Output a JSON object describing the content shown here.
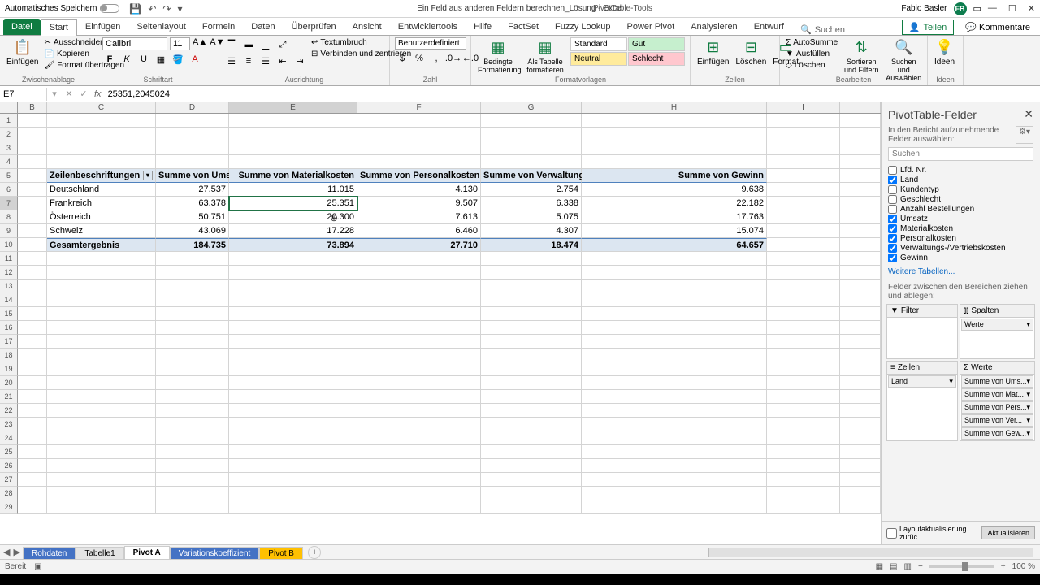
{
  "title_bar": {
    "autosave_label": "Automatisches Speichern",
    "doc_title": "Ein Feld aus anderen Feldern berechnen_Lösung - Excel",
    "pivot_tools": "PivotTable-Tools",
    "user_name": "Fabio Basler",
    "user_initials": "FB"
  },
  "tabs": {
    "file": "Datei",
    "home": "Start",
    "insert": "Einfügen",
    "pagelayout": "Seitenlayout",
    "formulas": "Formeln",
    "data": "Daten",
    "review": "Überprüfen",
    "view": "Ansicht",
    "developer": "Entwicklertools",
    "help": "Hilfe",
    "factset": "FactSet",
    "fuzzy": "Fuzzy Lookup",
    "powerpivot": "Power Pivot",
    "analyze": "Analysieren",
    "design": "Entwurf",
    "search": "Suchen",
    "share": "Teilen",
    "comments": "Kommentare"
  },
  "ribbon": {
    "paste": "Einfügen",
    "cut": "Ausschneiden",
    "copy": "Kopieren",
    "format_paint": "Format übertragen",
    "clipboard": "Zwischenablage",
    "font_name": "Calibri",
    "font_size": "11",
    "font_group": "Schriftart",
    "wrap": "Textumbruch",
    "merge": "Verbinden und zentrieren",
    "align_group": "Ausrichtung",
    "num_format": "Benutzerdefiniert",
    "num_group": "Zahl",
    "cond_fmt": "Bedingte Formatierung",
    "as_table": "Als Tabelle formatieren",
    "styles_group": "Formatvorlagen",
    "style_standard": "Standard",
    "style_gut": "Gut",
    "style_neutral": "Neutral",
    "style_schlecht": "Schlecht",
    "insert_cells": "Einfügen",
    "delete_cells": "Löschen",
    "format_cells": "Format",
    "cells_group": "Zellen",
    "autosum": "AutoSumme",
    "fill": "Ausfüllen",
    "clear": "Löschen",
    "sort": "Sortieren und Filtern",
    "find": "Suchen und Auswählen",
    "edit_group": "Bearbeiten",
    "ideas": "Ideen",
    "ideas_group": "Ideen"
  },
  "namebox": {
    "ref": "E7",
    "formula": "25351,2045024"
  },
  "cols": [
    "B",
    "C",
    "D",
    "E",
    "F",
    "G",
    "H",
    "I"
  ],
  "chart_data": {
    "type": "table",
    "title": "PivotTable",
    "columns": [
      "Zeilenbeschriftungen",
      "Summe von Umsatz",
      "Summe von Materialkosten",
      "Summe von Personalkosten",
      "Summe von Verwaltungs-/Vertriebskosten",
      "Summe von Gewinn"
    ],
    "rows": [
      {
        "label": "Deutschland",
        "vals": [
          "27.537",
          "11.015",
          "4.130",
          "2.754",
          "9.638"
        ]
      },
      {
        "label": "Frankreich",
        "vals": [
          "63.378",
          "25.351",
          "9.507",
          "6.338",
          "22.182"
        ]
      },
      {
        "label": "Österreich",
        "vals": [
          "50.751",
          "20.300",
          "7.613",
          "5.075",
          "17.763"
        ]
      },
      {
        "label": "Schweiz",
        "vals": [
          "43.069",
          "17.228",
          "6.460",
          "4.307",
          "15.074"
        ]
      }
    ],
    "total": {
      "label": "Gesamtergebnis",
      "vals": [
        "184.735",
        "73.894",
        "27.710",
        "18.474",
        "64.657"
      ]
    }
  },
  "pane": {
    "title": "PivotTable-Felder",
    "subtitle": "In den Bericht aufzunehmende Felder auswählen:",
    "search_ph": "Suchen",
    "fields": [
      {
        "name": "Lfd. Nr.",
        "checked": false
      },
      {
        "name": "Land",
        "checked": true
      },
      {
        "name": "Kundentyp",
        "checked": false
      },
      {
        "name": "Geschlecht",
        "checked": false
      },
      {
        "name": "Anzahl Bestellungen",
        "checked": false
      },
      {
        "name": "Umsatz",
        "checked": true
      },
      {
        "name": "Materialkosten",
        "checked": true
      },
      {
        "name": "Personalkosten",
        "checked": true
      },
      {
        "name": "Verwaltungs-/Vertriebskosten",
        "checked": true
      },
      {
        "name": "Gewinn",
        "checked": true
      }
    ],
    "more_tables": "Weitere Tabellen...",
    "areas_label": "Felder zwischen den Bereichen ziehen und ablegen:",
    "area_filter": "Filter",
    "area_cols": "Spalten",
    "area_rows": "Zeilen",
    "area_vals": "Werte",
    "col_items": [
      "Werte"
    ],
    "row_items": [
      "Land"
    ],
    "val_items": [
      "Summe von Ums...",
      "Summe von Mat...",
      "Summe von Pers...",
      "Summe von Ver...",
      "Summe von Gew..."
    ],
    "defer": "Layoutaktualisierung zurüc...",
    "update": "Aktualisieren"
  },
  "sheet_tabs": [
    "Rohdaten",
    "Tabelle1",
    "Pivot A",
    "Variationskoeffizient",
    "Pivot B"
  ],
  "status": {
    "ready": "Bereit",
    "zoom": "100 %"
  }
}
